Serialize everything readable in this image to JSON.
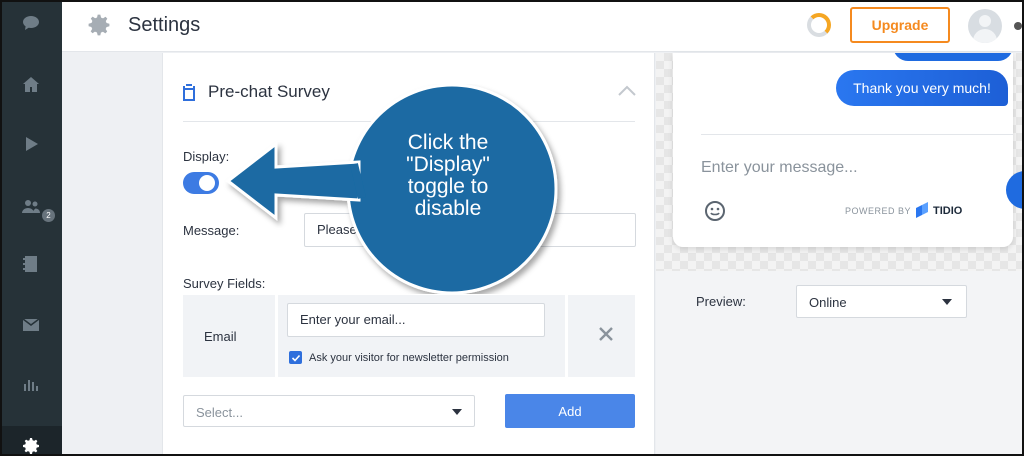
{
  "sidebar": {
    "items": [
      {
        "icon": "chat-icon"
      },
      {
        "icon": "home-icon"
      },
      {
        "icon": "play-icon"
      },
      {
        "icon": "visitors-icon",
        "badge": "2"
      },
      {
        "icon": "contacts-icon"
      },
      {
        "icon": "mail-icon"
      },
      {
        "icon": "analytics-icon"
      },
      {
        "icon": "settings-icon",
        "active": true
      }
    ]
  },
  "header": {
    "title": "Settings",
    "upgrade_label": "Upgrade"
  },
  "survey": {
    "section_title": "Pre-chat Survey",
    "display_label": "Display:",
    "display_enabled": true,
    "message_label": "Message:",
    "message_value": "Please i",
    "survey_fields_label": "Survey Fields:",
    "field": {
      "name": "Email",
      "placeholder": "Enter your email...",
      "checkbox_label": "Ask your visitor for newsletter permission",
      "checkbox_checked": true
    },
    "select_placeholder": "Select...",
    "add_label": "Add"
  },
  "preview": {
    "bubble_text": "Thank you very much!",
    "input_placeholder": "Enter your message...",
    "powered_by": "POWERED BY",
    "brand": "TIDIO",
    "label": "Preview:",
    "status_value": "Online"
  },
  "annotation": {
    "line1": "Click the",
    "line2": "\"Display\"",
    "line3": "toggle to",
    "line4": "disable",
    "color": "#1a6aa3"
  },
  "colors": {
    "accent": "#4a86e8",
    "upgrade": "#f58a1f",
    "sidebar": "#263238"
  }
}
